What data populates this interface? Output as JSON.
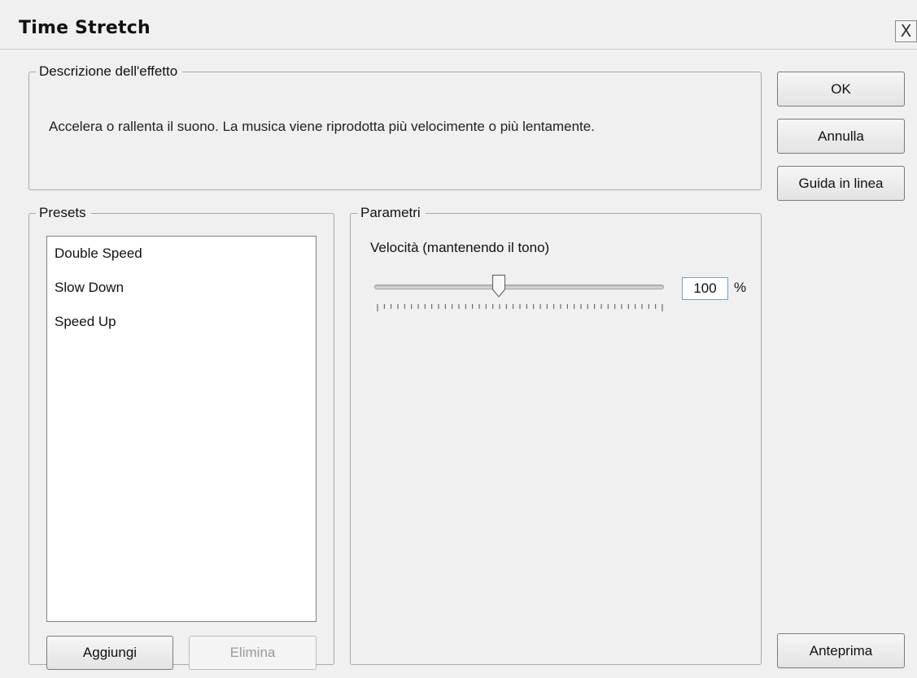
{
  "window": {
    "title": "Time Stretch",
    "close_glyph": "X"
  },
  "description": {
    "legend": "Descrizione dell'effetto",
    "text": "Accelera o rallenta il suono. La musica viene riprodotta più velocimente o più lentamente."
  },
  "buttons": {
    "ok": "OK",
    "cancel": "Annulla",
    "help": "Guida in linea",
    "preview": "Anteprima",
    "add": "Aggiungi",
    "delete": "Elimina"
  },
  "presets": {
    "legend": "Presets",
    "items": [
      "Double Speed",
      "Slow Down",
      "Speed Up"
    ]
  },
  "parameters": {
    "legend": "Parametri",
    "speed_label": "Velocità (mantenendo il tono)",
    "speed_value": "100",
    "speed_unit": "%",
    "slider_position_fraction": 0.43
  },
  "colors": {
    "dialog_bg": "#f0f0f0",
    "list_bg": "#ffffff",
    "disabled_text": "#9a9a9a"
  },
  "icons": {
    "close": "close-icon",
    "slider_thumb": "slider-thumb-icon"
  }
}
